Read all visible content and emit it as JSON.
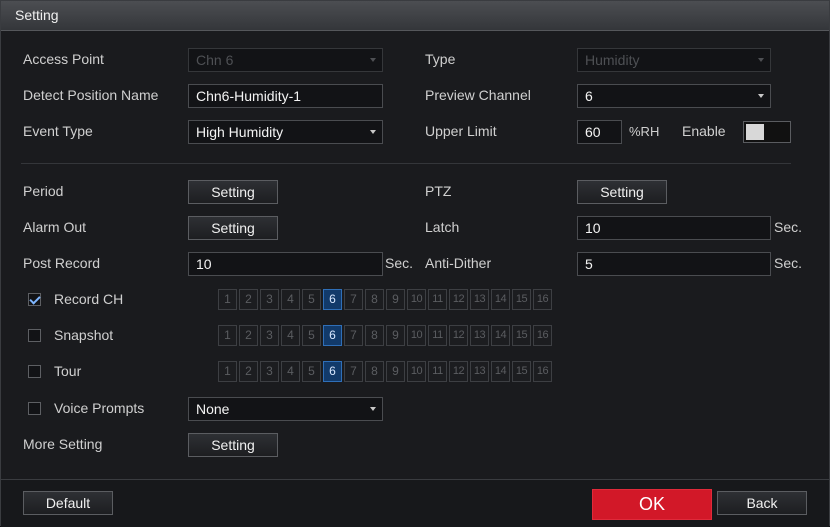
{
  "window": {
    "title": "Setting"
  },
  "left": {
    "access_point_label": "Access Point",
    "access_point_value": "Chn 6",
    "detect_position_label": "Detect Position Name",
    "detect_position_value": "Chn6-Humidity-1",
    "event_type_label": "Event Type",
    "event_type_value": "High Humidity",
    "period_label": "Period",
    "alarm_out_label": "Alarm Out",
    "post_record_label": "Post Record",
    "post_record_value": "10",
    "post_record_unit": "Sec.",
    "record_ch_label": "Record CH",
    "snapshot_label": "Snapshot",
    "tour_label": "Tour",
    "voice_prompts_label": "Voice Prompts",
    "voice_prompts_value": "None",
    "more_setting_label": "More Setting",
    "setting_button": "Setting"
  },
  "right": {
    "type_label": "Type",
    "type_value": "Humidity",
    "preview_channel_label": "Preview Channel",
    "preview_channel_value": "6",
    "upper_limit_label": "Upper Limit",
    "upper_limit_value": "60",
    "upper_limit_unit": "%RH",
    "enable_label": "Enable",
    "enable_on": false,
    "ptz_label": "PTZ",
    "latch_label": "Latch",
    "latch_value": "10",
    "latch_unit": "Sec.",
    "anti_dither_label": "Anti-Dither",
    "anti_dither_value": "5",
    "anti_dither_unit": "Sec."
  },
  "channels": {
    "labels": [
      "1",
      "2",
      "3",
      "4",
      "5",
      "6",
      "7",
      "8",
      "9",
      "10",
      "11",
      "12",
      "13",
      "14",
      "15",
      "16"
    ],
    "selected": "6",
    "record_ch_checked": true,
    "snapshot_checked": false,
    "tour_checked": false,
    "voice_prompts_checked": false
  },
  "footer": {
    "default_button": "Default",
    "ok_button": "OK",
    "back_button": "Back"
  },
  "colors": {
    "accent_ok": "#d21828",
    "selected_channel": "#123a6a"
  }
}
